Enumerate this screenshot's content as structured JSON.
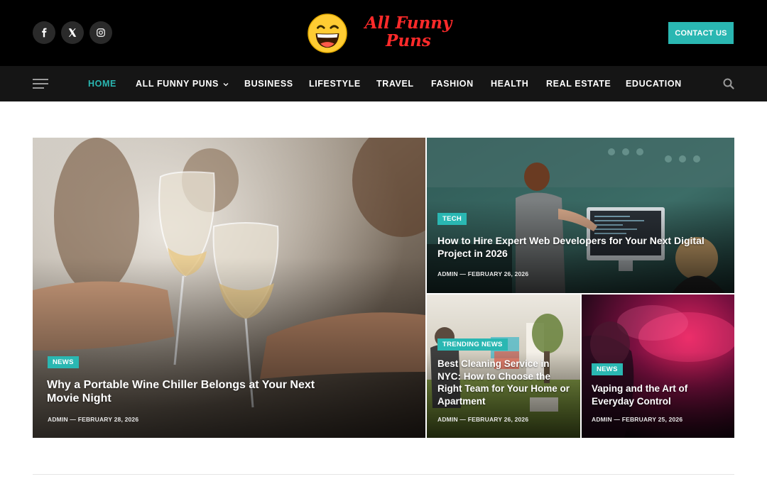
{
  "brand": {
    "name_line1": "All Funny",
    "name_line2": "Puns",
    "logo_icon": "laughing-face-emoji",
    "accent": "#2ab7b2",
    "logo_color": "#ff2a2a"
  },
  "social": [
    {
      "name": "facebook",
      "icon": "facebook-icon"
    },
    {
      "name": "x",
      "icon": "x-icon"
    },
    {
      "name": "instagram",
      "icon": "instagram-icon"
    }
  ],
  "header": {
    "contact_label": "CONTACT US"
  },
  "nav": {
    "items": [
      {
        "label": "HOME",
        "active": true
      },
      {
        "label": "ALL FUNNY PUNS",
        "has_dropdown": true
      },
      {
        "label": "BUSINESS"
      },
      {
        "label": "LIFESTYLE"
      },
      {
        "label": "TRAVEL"
      },
      {
        "label": "FASHION"
      },
      {
        "label": "HEALTH"
      },
      {
        "label": "REAL ESTATE"
      },
      {
        "label": "EDUCATION"
      }
    ],
    "search_icon": "search-icon",
    "menu_icon": "hamburger-menu-icon"
  },
  "featured": [
    {
      "category": "NEWS",
      "title": "Why a Portable Wine Chiller Belongs at Your Next Movie Night",
      "author": "ADMIN",
      "date": "FEBRUARY 28, 2026"
    },
    {
      "category": "TECH",
      "title": "How to Hire Expert Web Developers for Your Next Digital Project in 2026",
      "author": "ADMIN",
      "date": "FEBRUARY 26, 2026"
    },
    {
      "category": "TRENDING NEWS",
      "title": "Best Cleaning Service in NYC: How to Choose the Right Team for Your Home or Apartment",
      "author": "ADMIN",
      "date": "FEBRUARY 26, 2026"
    },
    {
      "category": "NEWS",
      "title": "Vaping and the Art of Everyday Control",
      "author": "ADMIN",
      "date": "FEBRUARY 25, 2026"
    }
  ],
  "meta_separator": "—"
}
